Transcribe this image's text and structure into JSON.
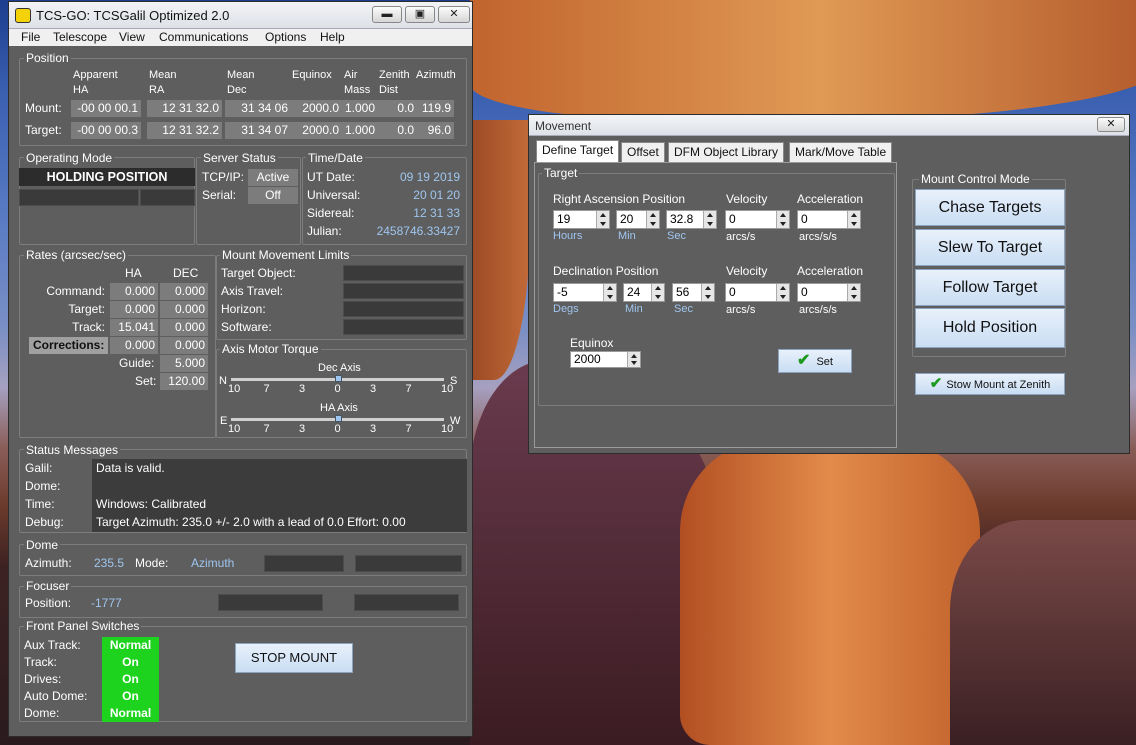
{
  "main_window": {
    "title": "TCS-GO: TCSGalil Optimized 2.0",
    "menu": [
      "File",
      "Telescope",
      "View",
      "Communications",
      "Options",
      "Help"
    ],
    "position": {
      "title": "Position",
      "headers": [
        [
          "Apparent",
          "HA"
        ],
        [
          "Mean",
          "RA"
        ],
        [
          "Mean",
          "Dec"
        ],
        [
          "Equinox",
          ""
        ],
        [
          "Air",
          "Mass"
        ],
        [
          "Zenith",
          "Dist"
        ],
        [
          "Azimuth",
          ""
        ]
      ],
      "rows": [
        {
          "label": "Mount:",
          "values": [
            "-00 00 00.1",
            "12 31 32.0",
            "31 34 06",
            "2000.0",
            "1.000",
            "0.0",
            "119.9"
          ]
        },
        {
          "label": "Target:",
          "values": [
            "-00 00 00.3",
            "12 31 32.2",
            "31 34 07",
            "2000.0",
            "1.000",
            "0.0",
            "96.0"
          ]
        }
      ]
    },
    "operating_mode": {
      "title": "Operating Mode",
      "value": "HOLDING POSITION"
    },
    "server_status": {
      "title": "Server Status",
      "tcpip_label": "TCP/IP:",
      "tcpip_value": "Active",
      "serial_label": "Serial:",
      "serial_value": "Off"
    },
    "time_date": {
      "title": "Time/Date",
      "rows": [
        {
          "label": "UT Date:",
          "value": "09 19 2019"
        },
        {
          "label": "Universal:",
          "value": "20 01 20"
        },
        {
          "label": "Sidereal:",
          "value": "12 31 33"
        },
        {
          "label": "Julian:",
          "value": "2458746.33427"
        }
      ]
    },
    "rates": {
      "title": "Rates (arcsec/sec)",
      "col_ha": "HA",
      "col_dec": "DEC",
      "rows": [
        {
          "label": "Command:",
          "ha": "0.000",
          "dec": "0.000"
        },
        {
          "label": "Target:",
          "ha": "0.000",
          "dec": "0.000"
        },
        {
          "label": "Track:",
          "ha": "15.041",
          "dec": "0.000"
        },
        {
          "label": "Corrections:",
          "ha": "0.000",
          "dec": "0.000"
        }
      ],
      "guide_label": "Guide:",
      "guide_value": "5.000",
      "set_label": "Set:",
      "set_value": "120.00"
    },
    "limits": {
      "title": "Mount Movement Limits",
      "rows": [
        "Target Object:",
        "Axis Travel:",
        "Horizon:",
        "Software:"
      ]
    },
    "torque": {
      "title": "Axis Motor Torque",
      "dec_label": "Dec Axis",
      "dec_left": "N",
      "dec_right": "S",
      "ha_label": "HA Axis",
      "ha_left": "E",
      "ha_right": "W",
      "scale": [
        "10",
        "7",
        "3",
        "0",
        "3",
        "7",
        "10"
      ],
      "dec_level": 0.5,
      "ha_level": 0.5
    },
    "status": {
      "title": "Status Messages",
      "rows": [
        {
          "label": "Galil:",
          "value": "Data is valid."
        },
        {
          "label": "Dome:",
          "value": ""
        },
        {
          "label": "Time:",
          "value": "Windows: Calibrated"
        },
        {
          "label": "Debug:",
          "value": "Target Azimuth: 235.0 +/- 2.0 with a lead of 0.0   Effort: 0.00"
        }
      ]
    },
    "dome": {
      "title": "Dome",
      "az_label": "Azimuth:",
      "az_value": "235.5",
      "mode_label": "Mode:",
      "mode_value": "Azimuth"
    },
    "focuser": {
      "title": "Focuser",
      "pos_label": "Position:",
      "pos_value": "-1777"
    },
    "switches": {
      "title": "Front Panel Switches",
      "rows": [
        {
          "label": "Aux Track:",
          "value": "Normal"
        },
        {
          "label": "Track:",
          "value": "On"
        },
        {
          "label": "Drives:",
          "value": "On"
        },
        {
          "label": "Auto Dome:",
          "value": "On"
        },
        {
          "label": "Dome:",
          "value": "Normal"
        }
      ]
    },
    "stop_button": "STOP MOUNT"
  },
  "movement_window": {
    "title": "Movement",
    "tabs": [
      "Define Target",
      "Offset",
      "DFM Object Library",
      "Mark/Move Table"
    ],
    "target_group": "Target",
    "ra_title": "Right Ascension Position",
    "ra": {
      "h": "19",
      "m": "20",
      "s": "32.8"
    },
    "ra_units": [
      "Hours",
      "Min",
      "Sec"
    ],
    "dec_title": "Declination Position",
    "dec": {
      "d": "-5",
      "m": "24",
      "s": "56"
    },
    "dec_units": [
      "Degs",
      "Min",
      "Sec"
    ],
    "velocity_title": "Velocity",
    "accel_title": "Acceleration",
    "ra_vel": "0",
    "ra_acc": "0",
    "dec_vel": "0",
    "dec_acc": "0",
    "vel_unit": "arcs/s",
    "acc_unit": "arcs/s/s",
    "equinox_title": "Equinox",
    "equinox": "2000",
    "set_button": "Set",
    "mode_group": "Mount Control Mode",
    "mode_buttons": [
      "Chase Targets",
      "Slew To Target",
      "Follow Target",
      "Hold Position"
    ],
    "stow_button": "Stow Mount at Zenith"
  }
}
